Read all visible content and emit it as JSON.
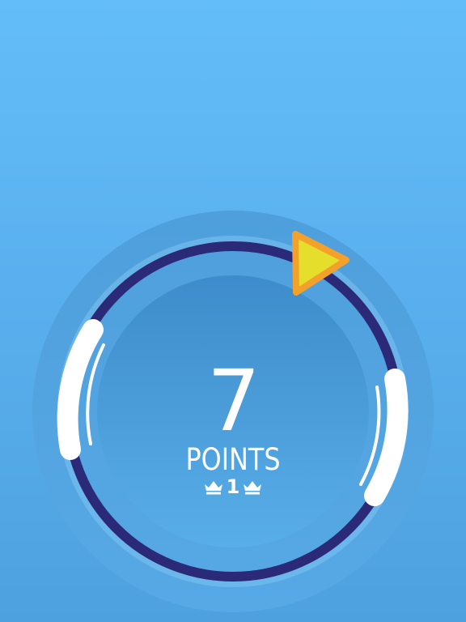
{
  "game": {
    "score": "7",
    "score_label": "POINTS",
    "best_score": "1",
    "best_icon": "crown-icon",
    "player_icon": "triangle-arrow-icon"
  },
  "colors": {
    "background_top": "#63bdf8",
    "background_bottom": "#4ea1df",
    "track": "#2b2a78",
    "paddle": "#ffffff",
    "player_fill": "#e5df2b",
    "player_stroke": "#f3a12a",
    "text": "#ffffff"
  }
}
